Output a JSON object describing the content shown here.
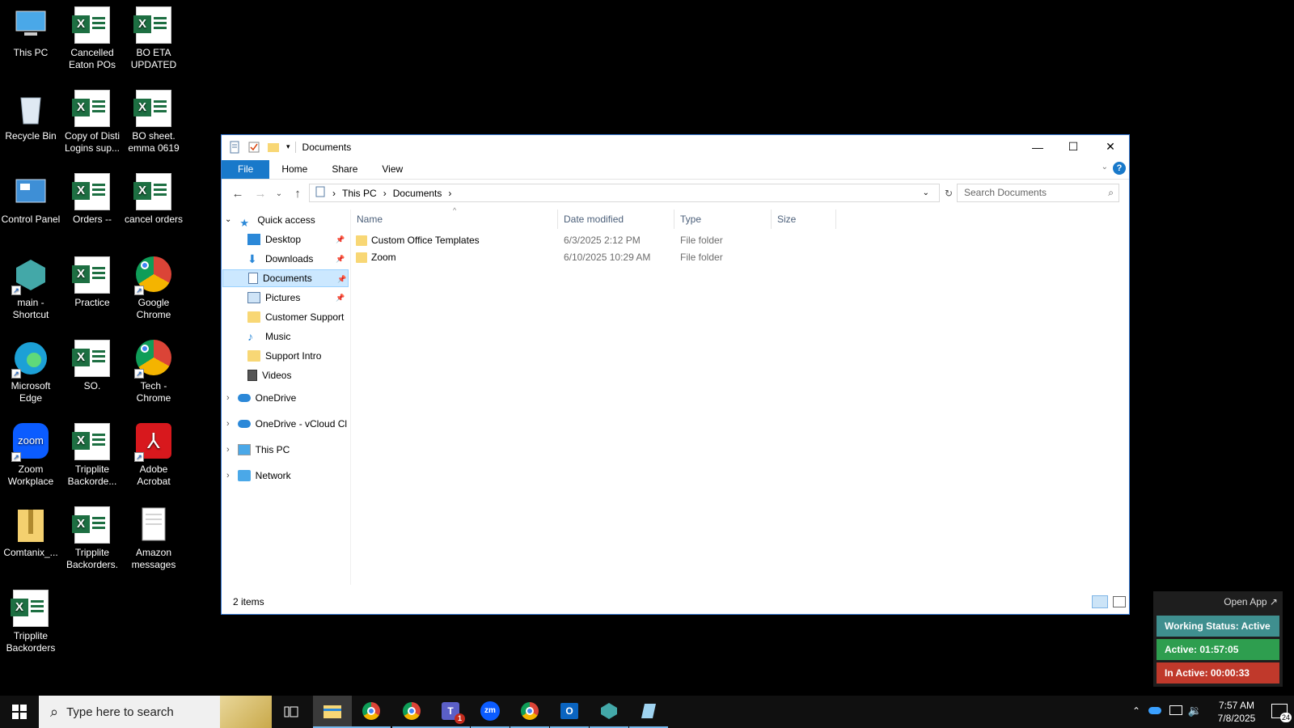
{
  "desktop": {
    "icons": [
      {
        "label": "This PC",
        "type": "pc"
      },
      {
        "label": "Cancelled Eaton POs",
        "type": "excel"
      },
      {
        "label": "BO ETA UPDATED",
        "type": "excel"
      },
      {
        "label": "Recycle Bin",
        "type": "recycle"
      },
      {
        "label": "Copy of Disti Logins sup...",
        "type": "excel"
      },
      {
        "label": "BO sheet. emma 0619",
        "type": "excel"
      },
      {
        "label": "Control Panel",
        "type": "control"
      },
      {
        "label": "Orders --",
        "type": "excel"
      },
      {
        "label": "cancel orders",
        "type": "excel"
      },
      {
        "label": "main - Shortcut",
        "type": "main"
      },
      {
        "label": "Practice",
        "type": "excel"
      },
      {
        "label": "Google Chrome",
        "type": "chrome"
      },
      {
        "label": "Microsoft Edge",
        "type": "edge"
      },
      {
        "label": "SO.",
        "type": "excel"
      },
      {
        "label": "Tech - Chrome",
        "type": "chrome"
      },
      {
        "label": "Zoom Workplace",
        "type": "zoom"
      },
      {
        "label": "Tripplite Backorde...",
        "type": "excel"
      },
      {
        "label": "Adobe Acrobat",
        "type": "acrobat"
      },
      {
        "label": "Comtanix_...",
        "type": "zip"
      },
      {
        "label": "Tripplite Backorders.",
        "type": "excel"
      },
      {
        "label": "Amazon messages",
        "type": "text"
      },
      {
        "label": "Tripplite Backorders",
        "type": "excel"
      }
    ]
  },
  "explorer": {
    "title": "Documents",
    "ribbon_tabs": [
      "File",
      "Home",
      "Share",
      "View"
    ],
    "breadcrumb": [
      "This PC",
      "Documents"
    ],
    "search_placeholder": "Search Documents",
    "nav": {
      "quick_access": "Quick access",
      "items": [
        {
          "label": "Desktop",
          "pinned": true,
          "icon": "desktop-icon"
        },
        {
          "label": "Downloads",
          "pinned": true,
          "icon": "download-icon"
        },
        {
          "label": "Documents",
          "pinned": true,
          "icon": "documents-icon",
          "selected": true
        },
        {
          "label": "Pictures",
          "pinned": true,
          "icon": "pictures-icon"
        },
        {
          "label": "Customer Support",
          "pinned": false,
          "icon": "folder-icon"
        },
        {
          "label": "Music",
          "pinned": false,
          "icon": "music-icon"
        },
        {
          "label": "Support Intro",
          "pinned": false,
          "icon": "folder-icon"
        },
        {
          "label": "Videos",
          "pinned": false,
          "icon": "videos-icon"
        }
      ],
      "roots": [
        {
          "label": "OneDrive",
          "icon": "cloud-icon"
        },
        {
          "label": "OneDrive - vCloud Cl",
          "icon": "cloud-icon"
        },
        {
          "label": "This PC",
          "icon": "pc-icon"
        },
        {
          "label": "Network",
          "icon": "network-icon"
        }
      ]
    },
    "columns": [
      "Name",
      "Date modified",
      "Type",
      "Size"
    ],
    "files": [
      {
        "name": "Custom Office Templates",
        "date": "6/3/2025 2:12 PM",
        "type": "File folder",
        "size": ""
      },
      {
        "name": "Zoom",
        "date": "6/10/2025 10:29 AM",
        "type": "File folder",
        "size": ""
      }
    ],
    "status": "2 items"
  },
  "tracker": {
    "open_app": "Open App ↗",
    "working_status": "Working Status: Active",
    "active": "Active: 01:57:05",
    "inactive": "In Active: 00:00:33",
    "colors": {
      "status": "#3f8f8f",
      "active": "#2e9e4f",
      "inactive": "#c0392b"
    }
  },
  "taskbar": {
    "search_placeholder": "Type here to search",
    "apps": [
      "file-explorer",
      "chrome",
      "chrome-profile",
      "teams",
      "zoom",
      "chrome-2",
      "outlook",
      "main-app",
      "notes"
    ],
    "teams_badge": "1",
    "time": "7:57 AM",
    "date": "7/8/2025",
    "notifications": "24"
  }
}
